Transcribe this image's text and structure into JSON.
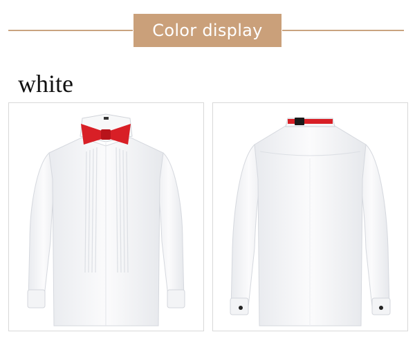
{
  "header": {
    "title": "Color display"
  },
  "color_name": "white",
  "product_views": [
    {
      "view": "front",
      "shirt_color": "#ffffff",
      "accessory": "red bow tie"
    },
    {
      "view": "back",
      "shirt_color": "#ffffff",
      "accessory": "red adjustable neck strap"
    }
  ],
  "colors": {
    "accent": "#caa07a",
    "bow_tie": "#d81f26",
    "panel_border": "#d8d8d8"
  }
}
